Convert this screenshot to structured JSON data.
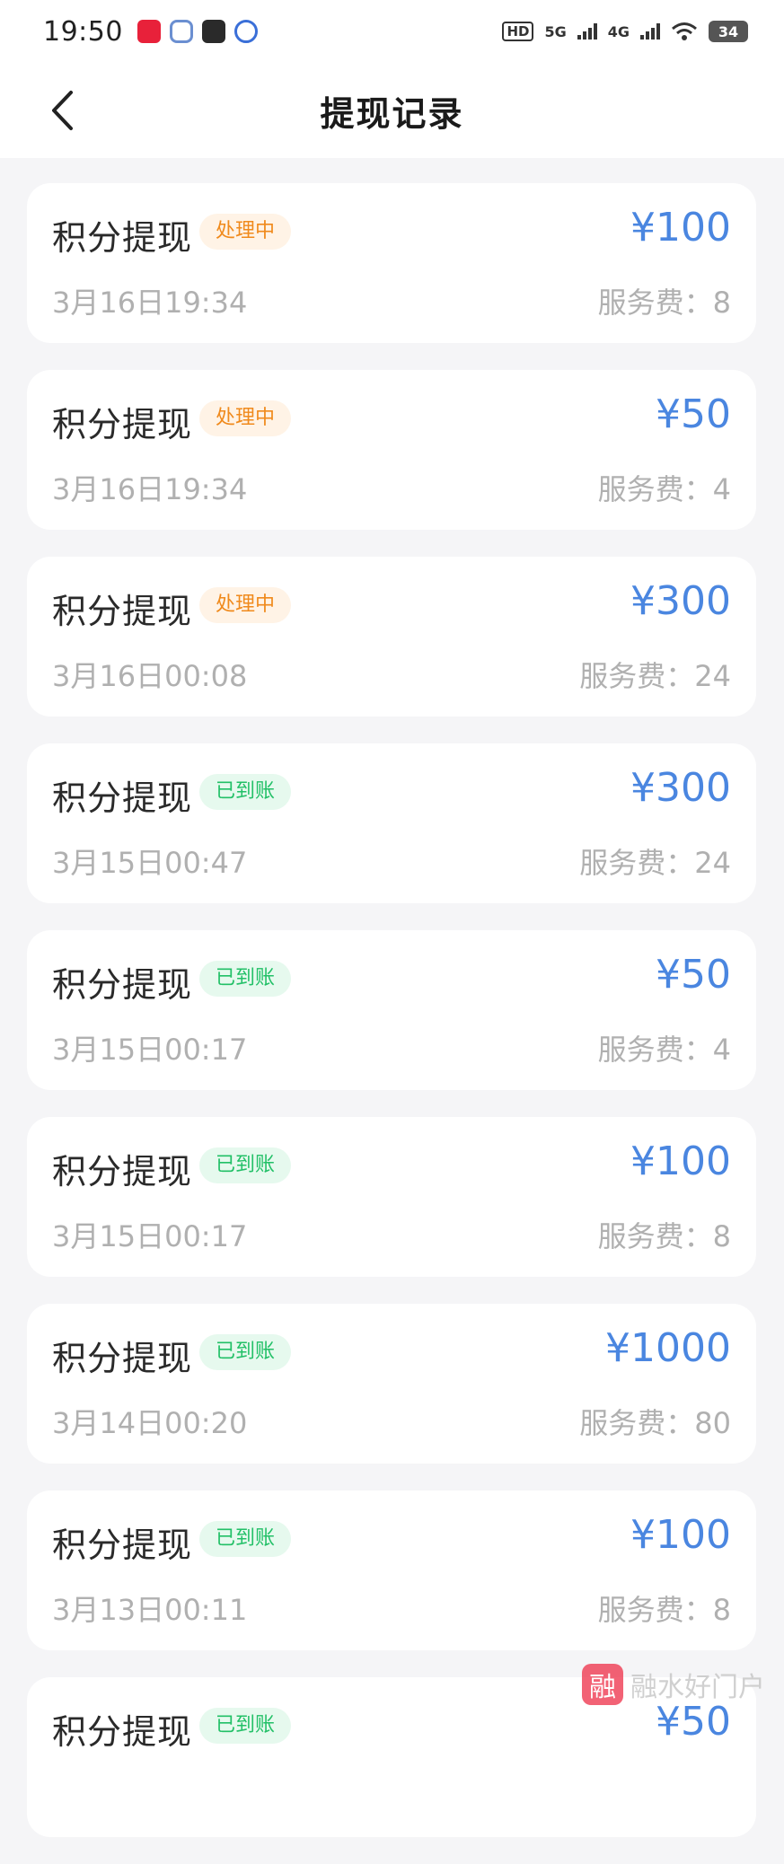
{
  "status_bar": {
    "time": "19:50",
    "notification_icons": [
      "xiaohongshu-icon",
      "cartoon-app-icon",
      "gallery-icon",
      "baidu-icon"
    ],
    "hd_label": "HD",
    "net1": "5G",
    "net2": "4G",
    "battery": "34"
  },
  "nav": {
    "title": "提现记录"
  },
  "records": [
    {
      "title": "积分提现",
      "status": "处理中",
      "state": "pending",
      "amount": "¥100",
      "date": "3月16日19:34",
      "fee": "服务费：8"
    },
    {
      "title": "积分提现",
      "status": "处理中",
      "state": "pending",
      "amount": "¥50",
      "date": "3月16日19:34",
      "fee": "服务费：4"
    },
    {
      "title": "积分提现",
      "status": "处理中",
      "state": "pending",
      "amount": "¥300",
      "date": "3月16日00:08",
      "fee": "服务费：24"
    },
    {
      "title": "积分提现",
      "status": "已到账",
      "state": "done",
      "amount": "¥300",
      "date": "3月15日00:47",
      "fee": "服务费：24"
    },
    {
      "title": "积分提现",
      "status": "已到账",
      "state": "done",
      "amount": "¥50",
      "date": "3月15日00:17",
      "fee": "服务费：4"
    },
    {
      "title": "积分提现",
      "status": "已到账",
      "state": "done",
      "amount": "¥100",
      "date": "3月15日00:17",
      "fee": "服务费：8"
    },
    {
      "title": "积分提现",
      "status": "已到账",
      "state": "done",
      "amount": "¥1000",
      "date": "3月14日00:20",
      "fee": "服务费：80"
    },
    {
      "title": "积分提现",
      "status": "已到账",
      "state": "done",
      "amount": "¥100",
      "date": "3月13日00:11",
      "fee": "服务费：8"
    },
    {
      "title": "积分提现",
      "status": "已到账",
      "state": "done",
      "amount": "¥50",
      "date": "",
      "fee": ""
    }
  ],
  "watermark": {
    "logo": "融",
    "text": "融水好门户"
  },
  "colors": {
    "amount": "#4a86e0",
    "pending_text": "#f08a1c",
    "pending_bg": "#fff3e6",
    "done_text": "#22c067",
    "done_bg": "#e6f9ee"
  }
}
